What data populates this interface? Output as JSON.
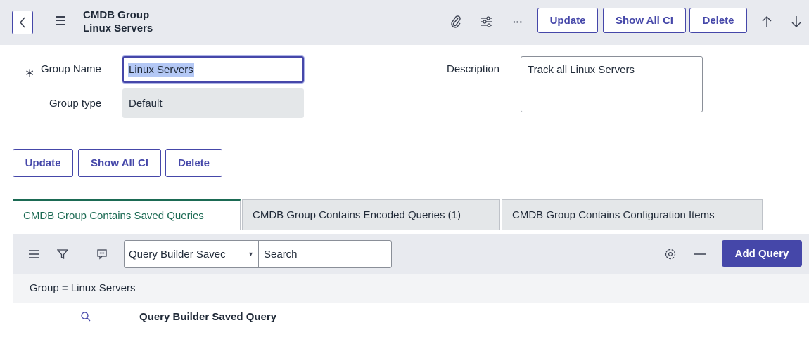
{
  "header": {
    "title_line1": "CMDB Group",
    "title_line2": "Linux Servers",
    "update_label": "Update",
    "show_all_ci_label": "Show All CI",
    "delete_label": "Delete",
    "more_label": "···"
  },
  "form": {
    "required_marker": "∗",
    "group_name_label": "Group Name",
    "group_name_value": "Linux Servers",
    "group_type_label": "Group type",
    "group_type_value": "Default",
    "description_label": "Description",
    "description_value": "Track all Linux Servers"
  },
  "actions": {
    "update_label": "Update",
    "show_all_ci_label": "Show All CI",
    "delete_label": "Delete"
  },
  "tabs": [
    {
      "label": "CMDB Group Contains Saved Queries",
      "active": true
    },
    {
      "label": "CMDB Group Contains Encoded Queries (1)",
      "active": false
    },
    {
      "label": "CMDB Group Contains Configuration Items",
      "active": false
    }
  ],
  "list": {
    "select_value": "Query Builder Savec",
    "search_placeholder": "Search",
    "add_button_label": "Add Query",
    "breadcrumb": "Group = Linux Servers",
    "column_header": "Query Builder Saved Query"
  },
  "colors": {
    "accent": "#4547a9",
    "active_tab": "#1b6a53",
    "header_bg": "#e8eaef"
  }
}
